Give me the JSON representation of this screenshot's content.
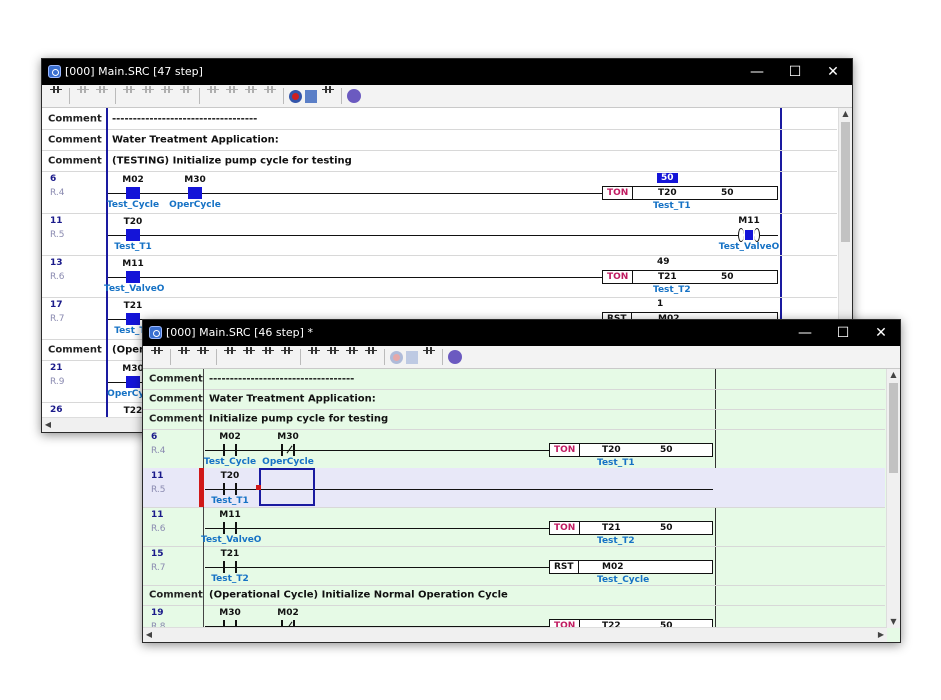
{
  "back_window": {
    "title": "[000] Main.SRC [47 step]",
    "controls": {
      "minimize": "—",
      "maximize": "☐",
      "close": "✕"
    },
    "rows": [
      {
        "kind": "comment",
        "label": "Comment",
        "text": "-----------------------------------"
      },
      {
        "kind": "comment",
        "label": "Comment",
        "text": "Water Treatment Application:"
      },
      {
        "kind": "comment",
        "label": "Comment",
        "text": "(TESTING) Initialize pump cycle for testing"
      },
      {
        "kind": "rung",
        "step": "6",
        "rn": "R.4",
        "contacts": [
          {
            "dev": "M02",
            "cmt": "Test_Cycle"
          },
          {
            "dev": "M30",
            "cmt": "OperCycle"
          }
        ],
        "fb": {
          "fn": "TON",
          "a1": "T20",
          "a2": "50"
        },
        "above": "50",
        "below": "Test_T1"
      },
      {
        "kind": "rung",
        "step": "11",
        "rn": "R.5",
        "contacts": [
          {
            "dev": "T20",
            "cmt": "Test_T1"
          }
        ],
        "coil": {
          "dev": "M11",
          "cmt": "Test_ValveO"
        }
      },
      {
        "kind": "rung",
        "step": "13",
        "rn": "R.6",
        "contacts": [
          {
            "dev": "M11",
            "cmt": "Test_ValveO"
          }
        ],
        "fb": {
          "fn": "TON",
          "a1": "T21",
          "a2": "50"
        },
        "above": "49",
        "below": "Test_T2"
      },
      {
        "kind": "rung",
        "step": "17",
        "rn": "R.7",
        "contacts": [
          {
            "dev": "T21",
            "cmt": "Test_T2"
          }
        ],
        "fb": {
          "fn": "RST",
          "a1": "M02",
          "a2": ""
        },
        "above": "1"
      },
      {
        "kind": "comment",
        "label": "Comment",
        "text": "(Operational Cycle) Initialize Normal Operation Cycle"
      },
      {
        "kind": "rung",
        "step": "21",
        "rn": "R.9",
        "contacts": [
          {
            "dev": "M30",
            "cmt": "OperCycle"
          }
        ]
      },
      {
        "kind": "rung",
        "step": "26",
        "rn": "",
        "contacts": [
          {
            "dev": "T22",
            "cmt": ""
          }
        ]
      }
    ]
  },
  "front_window": {
    "title": "[000] Main.SRC [46 step] *",
    "controls": {
      "minimize": "—",
      "maximize": "☐",
      "close": "✕"
    },
    "rows": [
      {
        "kind": "comment",
        "label": "Comment",
        "text": "-----------------------------------"
      },
      {
        "kind": "comment",
        "label": "Comment",
        "text": "Water Treatment Application:"
      },
      {
        "kind": "comment",
        "label": "Comment",
        "text": "Initialize pump cycle for testing"
      },
      {
        "kind": "rung",
        "step": "6",
        "rn": "R.4",
        "contacts": [
          {
            "dev": "M02",
            "cmt": "Test_Cycle"
          },
          {
            "dev": "M30",
            "cmt": "OperCycle"
          }
        ],
        "fb": {
          "fn": "TON",
          "a1": "T20",
          "a2": "50"
        },
        "below": "Test_T1"
      },
      {
        "kind": "rung",
        "step": "11",
        "rn": "R.5",
        "contacts": [
          {
            "dev": "T20",
            "cmt": "Test_T1"
          }
        ]
      },
      {
        "kind": "rung",
        "step": "11",
        "rn": "R.6",
        "contacts": [
          {
            "dev": "M11",
            "cmt": "Test_ValveO"
          }
        ],
        "fb": {
          "fn": "TON",
          "a1": "T21",
          "a2": "50"
        },
        "below": "Test_T2"
      },
      {
        "kind": "rung",
        "step": "15",
        "rn": "R.7",
        "contacts": [
          {
            "dev": "T21",
            "cmt": "Test_T2"
          }
        ],
        "fb": {
          "fn": "RST",
          "a1": "M02",
          "a2": ""
        },
        "below": "Test_Cycle"
      },
      {
        "kind": "comment",
        "label": "Comment",
        "text": "(Operational Cycle) Initialize Normal Operation Cycle"
      },
      {
        "kind": "rung",
        "step": "19",
        "rn": "R.8",
        "contacts": [
          {
            "dev": "M30",
            "cmt": ""
          },
          {
            "dev": "M02",
            "cmt": ""
          }
        ],
        "fb": {
          "fn": "TON",
          "a1": "T22",
          "a2": "50"
        }
      }
    ]
  },
  "toolbar_icons": [
    "esc-icon",
    "convert-icon",
    "f2-icon",
    "f4-icon",
    "f5-icon",
    "f6-icon",
    "f7-icon",
    "f8-icon",
    "f9-icon",
    "f10-icon",
    "f12-icon",
    "run-icon",
    "monitor-icon",
    "edit-icon",
    "wizard-icon"
  ],
  "colors": {
    "active_contact": "#1414d8",
    "function_name": "#c01a60",
    "comment_text": "#1672c5",
    "editor_bg_front": "#e6fae6",
    "selection_row": "#e8e8f8",
    "cursor_bar": "#d01818"
  }
}
